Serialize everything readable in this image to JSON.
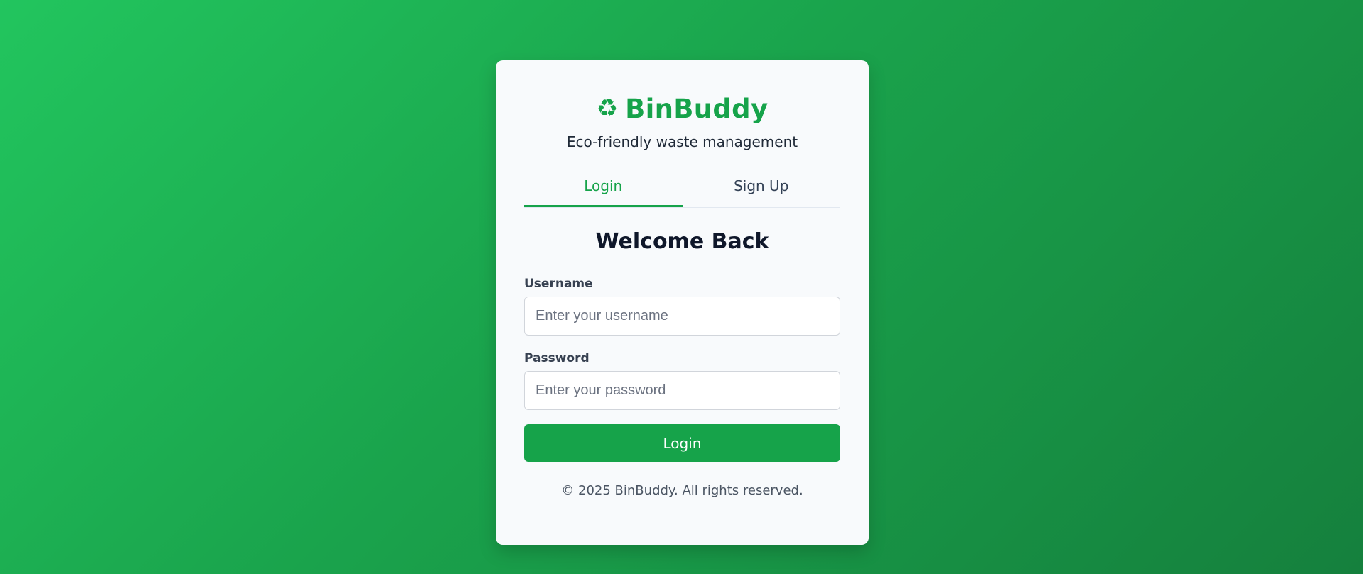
{
  "brand": {
    "icon": "recycle-icon",
    "icon_glyph": "♻",
    "name": "BinBuddy",
    "tagline": "Eco-friendly waste management"
  },
  "tabs": [
    {
      "label": "Login",
      "active": true
    },
    {
      "label": "Sign Up",
      "active": false
    }
  ],
  "form": {
    "heading": "Welcome Back",
    "username_label": "Username",
    "username_placeholder": "Enter your username",
    "username_value": "",
    "password_label": "Password",
    "password_placeholder": "Enter your password",
    "password_value": "",
    "submit_label": "Login"
  },
  "footer": {
    "text": "© 2025 BinBuddy. All rights reserved."
  },
  "colors": {
    "accent": "#16a34a",
    "background_start": "#22c55e",
    "background_end": "#15803d",
    "card": "#f8fafc"
  }
}
